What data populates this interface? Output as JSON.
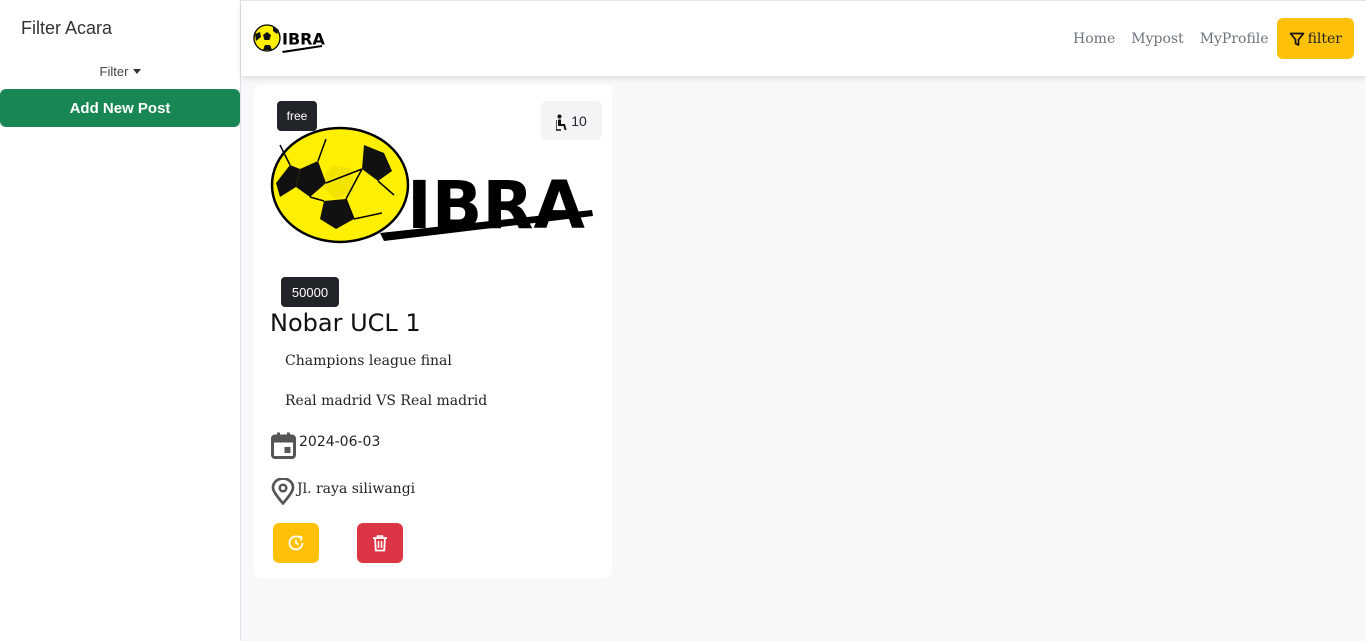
{
  "sidebar": {
    "title": "Filter Acara",
    "filter_label": "Filter",
    "add_button_label": "Add New Post"
  },
  "navbar": {
    "brand_text": "IBRA",
    "links": [
      "Home",
      "Mypost",
      "MyProfile"
    ],
    "filter_button_label": "filter"
  },
  "post_card": {
    "badge_free": "free",
    "capacity": "10",
    "logo_text": "IBRA",
    "price": "50000",
    "title": "Nobar UCL 1",
    "description_1": "Champions league final",
    "description_2": "Real madrid VS Real madrid",
    "date": "2024-06-03",
    "location": "Jl. raya siliwangi"
  },
  "colors": {
    "success": "#198754",
    "warning": "#ffc107",
    "danger": "#dc3545",
    "dark": "#212529",
    "ball_yellow": "#ffef00"
  },
  "icons": [
    "filter-icon",
    "person-seat-icon",
    "calendar-icon",
    "location-pin-icon",
    "clock-refresh-icon",
    "trash-icon",
    "soccer-ball-logo"
  ]
}
